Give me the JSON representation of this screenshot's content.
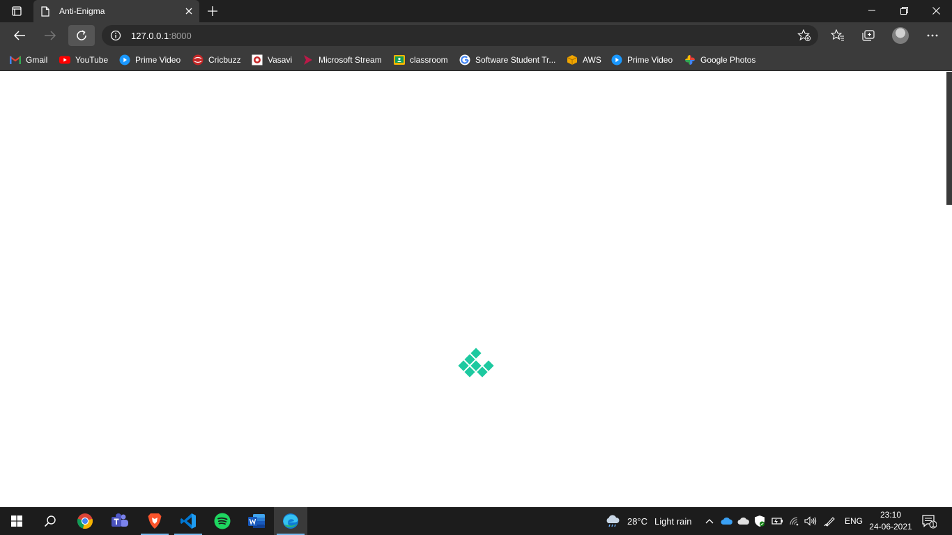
{
  "browser": {
    "tab": {
      "title": "Anti-Enigma"
    },
    "address": {
      "host": "127.0.0.1",
      "port": ":8000"
    }
  },
  "bookmarks": [
    {
      "label": "Gmail",
      "icon": "gmail-icon",
      "color": "#ea4335"
    },
    {
      "label": "YouTube",
      "icon": "youtube-icon",
      "color": "#ff0000"
    },
    {
      "label": "Prime Video",
      "icon": "prime-video-icon",
      "color": "#1a98ff"
    },
    {
      "label": "Cricbuzz",
      "icon": "cricbuzz-icon",
      "color": "#d32f2f"
    },
    {
      "label": "Vasavi",
      "icon": "vasavi-icon",
      "color": "#c62828"
    },
    {
      "label": "Microsoft Stream",
      "icon": "microsoft-stream-icon",
      "color": "#bc1948"
    },
    {
      "label": "classroom",
      "icon": "classroom-icon",
      "color": "#f4b400"
    },
    {
      "label": "Software Student Tr...",
      "icon": "google-icon",
      "color": "#4285f4"
    },
    {
      "label": "AWS",
      "icon": "aws-icon",
      "color": "#f0a500"
    },
    {
      "label": "Prime Video",
      "icon": "prime-video-icon",
      "color": "#1a98ff"
    },
    {
      "label": "Google Photos",
      "icon": "google-photos-icon",
      "color": "#fbbc04"
    }
  ],
  "page": {
    "loader_color": "#1dc9a0"
  },
  "taskbar": {
    "weather": {
      "temp": "28°C",
      "condition": "Light rain"
    },
    "language": "ENG",
    "time": "23:10",
    "date": "24-06-2021",
    "notification_count": "1"
  }
}
